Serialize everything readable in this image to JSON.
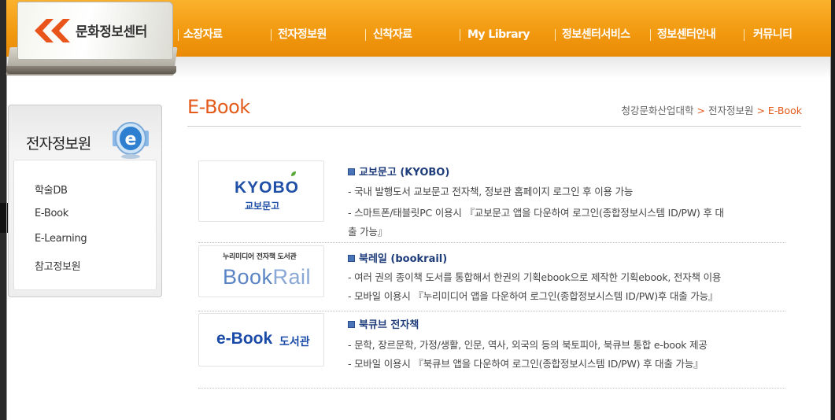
{
  "header": {
    "logo_text": "문화정보센터",
    "nav": [
      {
        "label": "소장자료"
      },
      {
        "label": "전자정보원"
      },
      {
        "label": "신착자료"
      },
      {
        "label": "My Library"
      },
      {
        "label": "정보센터서비스"
      },
      {
        "label": "정보센터안내"
      },
      {
        "label": "커뮤니티"
      }
    ]
  },
  "sidebar": {
    "title": "전자정보원",
    "icon": "e-icon",
    "items": [
      {
        "label": "학술DB"
      },
      {
        "label": "E-Book"
      },
      {
        "label": "E-Learning"
      },
      {
        "label": "참고정보원"
      }
    ]
  },
  "main": {
    "page_title": "E-Book",
    "breadcrumb": {
      "root": "청강문화산업대학",
      "sep": ">",
      "section": "전자정보원",
      "current": "E-Book"
    },
    "entries": [
      {
        "logo": {
          "word": "KYOBO",
          "sub": "교보문고"
        },
        "title": "교보문고 (KYOBO)",
        "lines": [
          "- 국내 발행도서 교보문고 전자책, 정보관 홈페이지 로그인 후 이용 가능",
          "- 스마트폰/태블릿PC 이용시 『교보문고 앱을 다운하여 로그인(종합정보시스템 ID/PW) 후 대",
          "출 가능』"
        ]
      },
      {
        "logo": {
          "top": "누리미디어 전자책 도서관",
          "word_a": "Book",
          "word_b": "Rail"
        },
        "title": "북레일 (bookrail)",
        "lines": [
          "- 여러 권의 종이책 도서를 통합해서 한권의 기획ebook으로 제작한 기획ebook, 전자책 이용",
          "- 모바일 이용시 『누리미디어 앱을 다운하여 로그인(종합정보시스템 ID/PW)후 대출 가능』"
        ]
      },
      {
        "logo": {
          "word": "e-Book",
          "sub": "도서관"
        },
        "title": "북큐브 전자책",
        "lines": [
          "- 문학, 장르문학, 가정/생활, 인문, 역사, 외국의 등의 북토피아, 북큐브 통합 e-book 제공",
          "- 모바일 이용시 『북큐브 앱을 다운하여 로그인(종합정보시스템 ID/PW) 후 대출 가능』"
        ]
      }
    ]
  },
  "colors": {
    "nav_bg": "#f29a10",
    "accent": "#e35a1a",
    "entry_title": "#1f3d7a",
    "logo_blue": "#1f4fa6"
  }
}
